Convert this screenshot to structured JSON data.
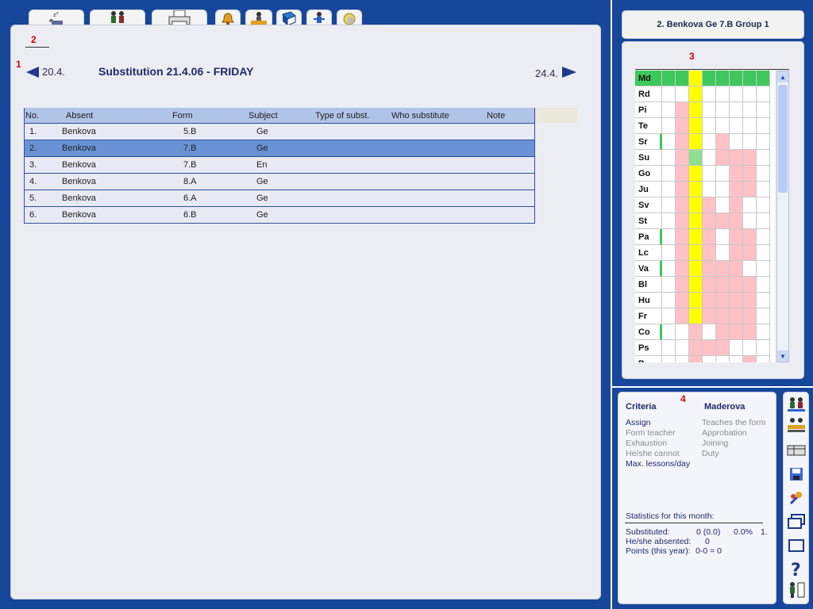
{
  "tabs": [
    {
      "name": "tab-absences",
      "icon": "sleep-icon"
    },
    {
      "name": "tab-substitutions",
      "icon": "teachers-icon"
    },
    {
      "name": "tab-print",
      "icon": "printer-icon"
    },
    {
      "name": "tab-bell",
      "icon": "bell-icon"
    },
    {
      "name": "tab-teacher",
      "icon": "teacher-desk-icon"
    },
    {
      "name": "tab-book",
      "icon": "book-icon"
    },
    {
      "name": "tab-duty",
      "icon": "person-icon"
    },
    {
      "name": "tab-settings",
      "icon": "gear-icon"
    }
  ],
  "markers": {
    "m1": "1",
    "m2": "2",
    "m3": "3",
    "m4": "4"
  },
  "nav": {
    "prev_date": "20.4.",
    "next_date": "24.4.",
    "title": "Substitution 21.4.06 - FRIDAY"
  },
  "table": {
    "columns": [
      "No.",
      "Absent",
      "Form",
      "Subject",
      "Type of subst.",
      "Who substitute",
      "Note"
    ],
    "rows": [
      {
        "no": "1.",
        "absent": "Benkova",
        "form": "5.B",
        "subject": "Ge",
        "type": "",
        "who": "",
        "note": ""
      },
      {
        "no": "2.",
        "absent": "Benkova",
        "form": "7.B",
        "subject": "Ge",
        "type": "",
        "who": "",
        "note": ""
      },
      {
        "no": "3.",
        "absent": "Benkova",
        "form": "7.B",
        "subject": "En",
        "type": "",
        "who": "",
        "note": ""
      },
      {
        "no": "4.",
        "absent": "Benkova",
        "form": "8.A",
        "subject": "Ge",
        "type": "",
        "who": "",
        "note": ""
      },
      {
        "no": "5.",
        "absent": "Benkova",
        "form": "6.A",
        "subject": "Ge",
        "type": "",
        "who": "",
        "note": ""
      },
      {
        "no": "6.",
        "absent": "Benkova",
        "form": "6.B",
        "subject": "Ge",
        "type": "",
        "who": "",
        "note": ""
      }
    ],
    "selected_row": 1
  },
  "right": {
    "header": "2. Benkova Ge 7.B Group 1",
    "teachers": [
      "Md",
      "Rd",
      "Pi",
      "Te",
      "Sr",
      "Su",
      "Go",
      "Ju",
      "Sv",
      "St",
      "Pa",
      "Lc",
      "Va",
      "Bl",
      "Hu",
      "Fr",
      "Co",
      "Ps",
      "P"
    ]
  },
  "criteria": {
    "title": "Criteria",
    "teacher": "Maderova",
    "left": [
      "Assign",
      "Form teacher",
      "Exhaustion",
      "He/she cannot",
      "Max. lessons/day"
    ],
    "right": [
      "Teaches the form",
      "Approbation",
      "Joining",
      "Duty"
    ],
    "stats_title": "Statistics for this month:",
    "substituted_label": "Substituted:",
    "substituted_value": "0 (0.0)",
    "substituted_pct": "0.0%",
    "substituted_rank": "1.",
    "absented_label": "He/she absented:",
    "absented_value": "0",
    "points_label": "Points (this year):",
    "points_value": "0-0 = 0"
  },
  "toolbar": [
    "teachers-icon",
    "teacher-desk-icon",
    "timetable-icon",
    "save-icon",
    "tools-icon",
    "windows-icon",
    "window-icon",
    "help-icon",
    "exit-icon"
  ],
  "colors": {
    "background": "#17479b",
    "header_row": "#b0c4e8",
    "selected_row": "#6a93d6",
    "free": "#ffffff",
    "busy": "#ffc0c6",
    "current": "#ffff00",
    "available": "#3cc85a"
  }
}
